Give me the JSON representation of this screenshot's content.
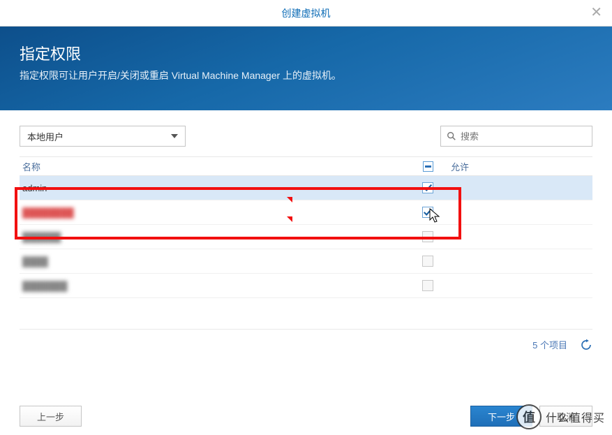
{
  "window": {
    "title": "创建虚拟机"
  },
  "hero": {
    "title": "指定权限",
    "subtitle": "指定权限可让用户开启/关闭或重启 Virtual Machine Manager 上的虚拟机。"
  },
  "toolbar": {
    "user_scope": "本地用户",
    "search_placeholder": "搜索"
  },
  "table": {
    "headers": {
      "name": "名称",
      "allow": "允许"
    },
    "rows": [
      {
        "name": "admin",
        "checked": true,
        "selected": true,
        "blur": "none"
      },
      {
        "name": "████████",
        "checked": true,
        "selected": false,
        "blur": "red"
      },
      {
        "name": "██████",
        "checked": false,
        "selected": false,
        "blur": "gray"
      },
      {
        "name": "████",
        "checked": false,
        "selected": false,
        "blur": "gray"
      },
      {
        "name": "███████",
        "checked": false,
        "selected": false,
        "blur": "gray"
      }
    ],
    "item_count": "5 个项目"
  },
  "buttons": {
    "back": "上一步",
    "next": "下一步",
    "cancel": "取消"
  },
  "watermark": {
    "badge": "值",
    "text": "什么值得买"
  }
}
